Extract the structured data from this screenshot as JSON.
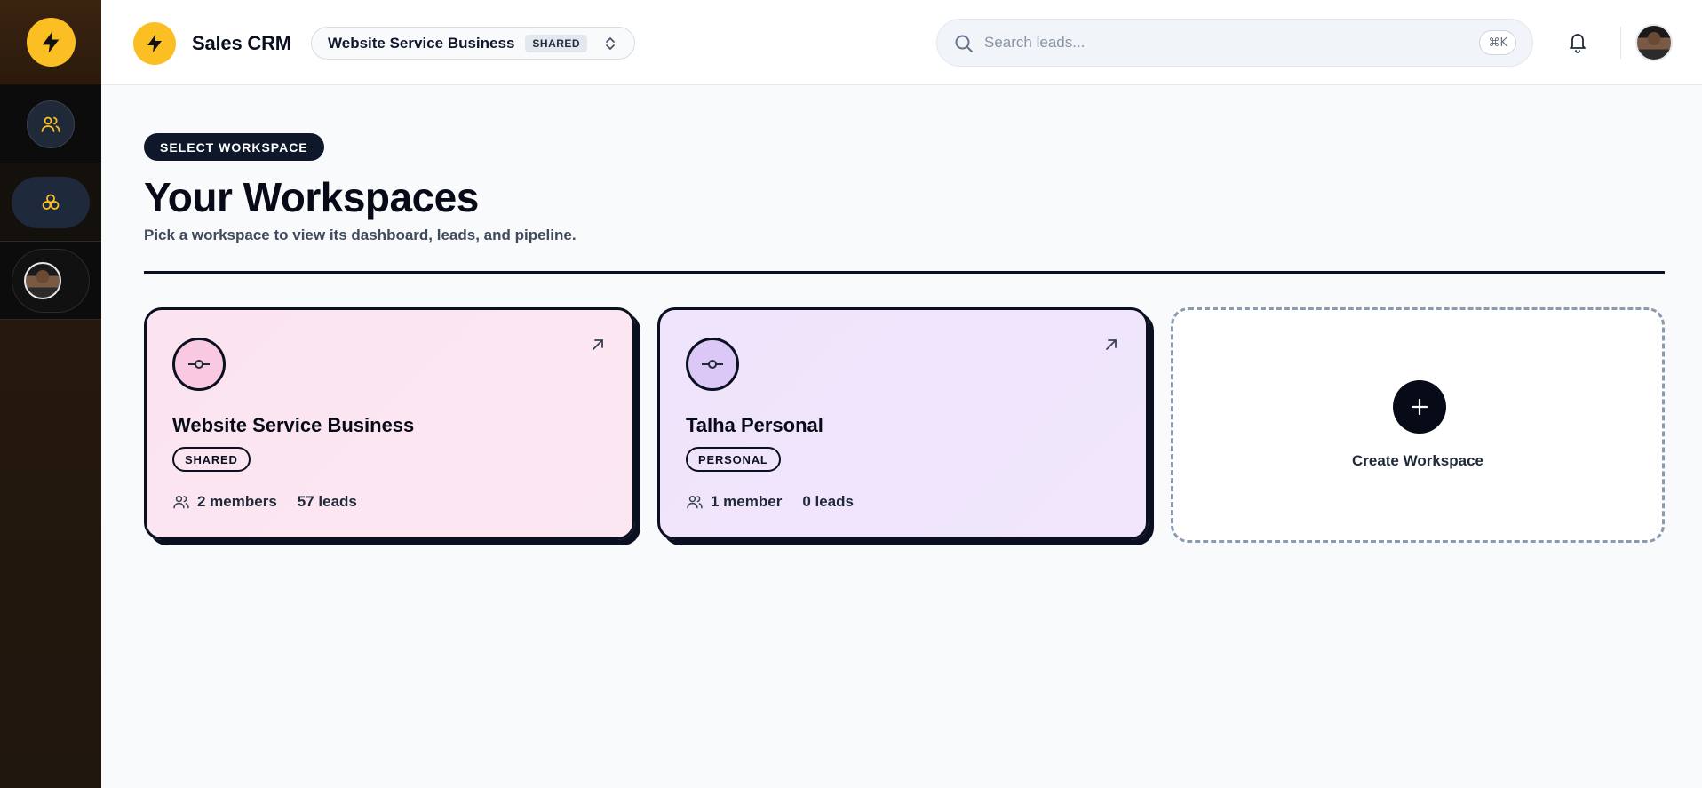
{
  "app": {
    "name": "Sales CRM",
    "accent": "#fbbf24"
  },
  "header": {
    "workspace_switcher": {
      "name": "Website Service Business",
      "badge": "SHARED"
    },
    "search": {
      "placeholder": "Search leads...",
      "shortcut": "⌘K"
    }
  },
  "sidebar": {
    "items": [
      {
        "icon": "users-icon"
      },
      {
        "icon": "workspaces-icon",
        "active": true
      },
      {
        "icon": "avatar"
      }
    ]
  },
  "main": {
    "eyebrow": "SELECT WORKSPACE",
    "title": "Your Workspaces",
    "subtitle": "Pick a workspace to view its dashboard, leads, and pipeline.",
    "workspaces": [
      {
        "name": "Website Service Business",
        "badge": "SHARED",
        "members": "2 members",
        "leads": "57 leads",
        "color": "#fbe4f0"
      },
      {
        "name": "Talha Personal",
        "badge": "PERSONAL",
        "members": "1 member",
        "leads": "0 leads",
        "color": "#efe4fb"
      }
    ],
    "create_label": "Create Workspace"
  }
}
